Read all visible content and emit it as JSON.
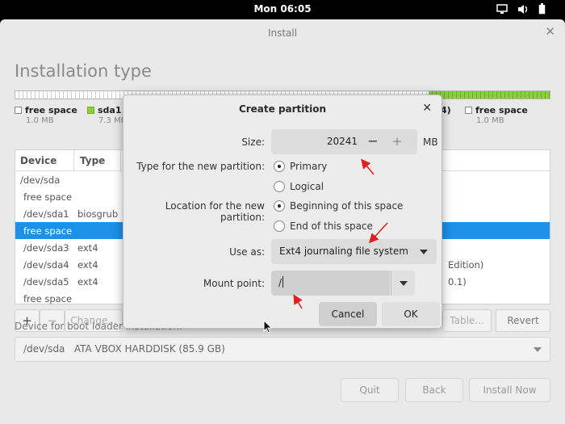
{
  "topbar": {
    "clock": "Mon 06:05",
    "tray_icons": [
      "screen-icon",
      "volume-icon",
      "battery-icon"
    ]
  },
  "window": {
    "title": "Install",
    "page_title": "Installation type"
  },
  "legend": [
    {
      "name": "free space",
      "size": "1.0 MB",
      "color": "#ffffff"
    },
    {
      "name": "sda1",
      "size": "7.3 MB",
      "color": "#8ccf3c"
    },
    {
      "name": "4)",
      "size": "",
      "color": ""
    },
    {
      "name": "free space",
      "size": "1.0 MB",
      "color": "#ffffff"
    }
  ],
  "table": {
    "headers": [
      "Device",
      "Type"
    ],
    "rows": [
      {
        "device": "/dev/sda",
        "type": "",
        "extra": ""
      },
      {
        "device": "free space",
        "type": "",
        "extra": ""
      },
      {
        "device": "/dev/sda1",
        "type": "biosgrub",
        "extra": ""
      },
      {
        "device": "free space",
        "type": "",
        "extra": ""
      },
      {
        "device": "/dev/sda3",
        "type": "ext4",
        "extra": ""
      },
      {
        "device": "/dev/sda4",
        "type": "ext4",
        "extra": "Edition)"
      },
      {
        "device": "/dev/sda5",
        "type": "ext4",
        "extra": "0.1)"
      },
      {
        "device": "free space",
        "type": "",
        "extra": ""
      }
    ],
    "selected_row": 3
  },
  "toolbar": {
    "add": "+",
    "remove": "−",
    "change": "Change...",
    "new_table": "Table...",
    "revert": "Revert"
  },
  "boot": {
    "label": "Device for boot loader installation:",
    "device": "/dev/sda",
    "disk": "ATA VBOX HARDDISK (85.9 GB)"
  },
  "footer": {
    "quit": "Quit",
    "back": "Back",
    "install": "Install Now"
  },
  "dialog": {
    "title": "Create partition",
    "size_label": "Size:",
    "size_value": "20241",
    "size_unit": "MB",
    "type_label": "Type for the new partition:",
    "type_primary": "Primary",
    "type_logical": "Logical",
    "type_selected": "Primary",
    "location_label": "Location for the new partition:",
    "location_beginning": "Beginning of this space",
    "location_end": "End of this space",
    "location_selected": "Beginning of this space",
    "useas_label": "Use as:",
    "useas_value": "Ext4 journaling file system",
    "mount_label": "Mount point:",
    "mount_value": "/",
    "cancel": "Cancel",
    "ok": "OK"
  },
  "colors": {
    "selection": "#1e90e6",
    "annotation_arrow": "#e02020",
    "partition_green": "#8ccf3c"
  }
}
